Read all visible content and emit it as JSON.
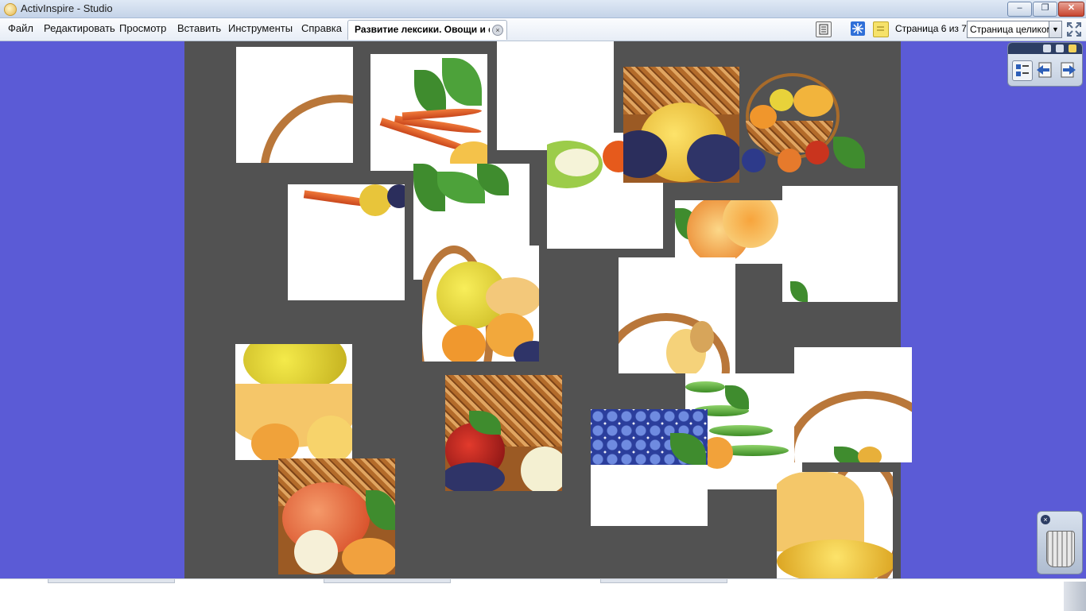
{
  "window": {
    "title": "ActivInspire - Studio",
    "controls": [
      "minimize",
      "restore",
      "close"
    ]
  },
  "menu": {
    "items": [
      "Файл",
      "Редактировать",
      "Просмотр",
      "Вставить",
      "Инструменты",
      "Справка"
    ]
  },
  "document_tab": {
    "label": "Развитие лексики. Овощи и фр",
    "close_symbol": "×"
  },
  "toolbar": {
    "page_indicator": "Страница 6 из 7",
    "zoom_value": "Страница целиком",
    "zoom_arrow": "▼",
    "icons": [
      "page-list-icon",
      "snowflake-icon",
      "sticky-note-icon",
      "fullscreen-icon"
    ]
  },
  "toolbox": {
    "icons": [
      "page-browser-icon",
      "previous-page-icon",
      "next-page-icon"
    ]
  },
  "trash": {
    "close_symbol": "×",
    "icon": "trash-bin-icon"
  },
  "colors": {
    "desktop": "#5b5bd6",
    "canvas": "#525252",
    "piece": "#ffffff"
  },
  "canvas": {
    "content": "fruit-basket-puzzle",
    "piece_count": 21
  }
}
